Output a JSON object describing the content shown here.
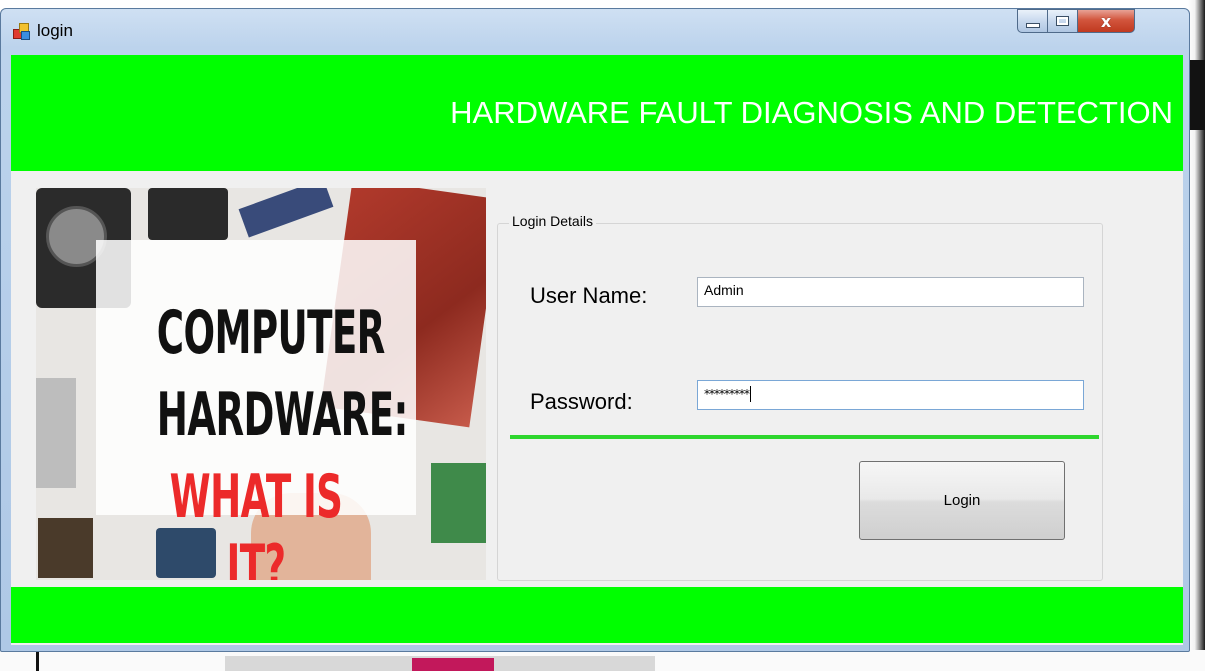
{
  "window": {
    "title": "login",
    "icon": "app-form-icon",
    "controls": {
      "minimize_icon": "minimize-icon",
      "maximize_icon": "maximize-icon",
      "close_glyph": "x"
    }
  },
  "header": {
    "title": "HARDWARE FAULT DIAGNOSIS AND DETECTION",
    "background": "#00ff00"
  },
  "picture": {
    "line1": "COMPUTER",
    "line2": "HARDWARE:",
    "line3": "WHAT IS IT?"
  },
  "login_group": {
    "legend": "Login Details",
    "username_label": "User Name:",
    "username_value": "Admin",
    "password_label": "Password:",
    "password_value": "*********",
    "login_button": "Login"
  },
  "colors": {
    "accent_green": "#00ff00",
    "separator_green": "#2ed62e",
    "picture_highlight_red": "#ec2a2a"
  }
}
